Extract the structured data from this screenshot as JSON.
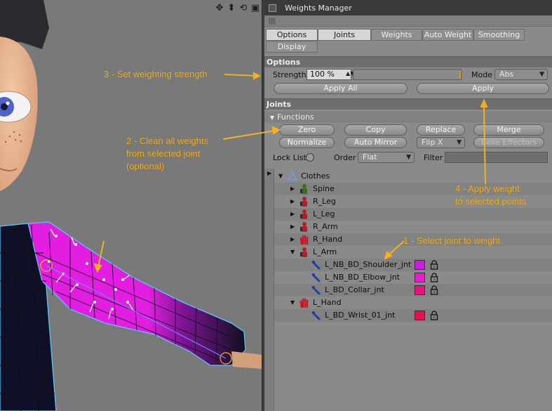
{
  "viewport": {
    "tools": {
      "move": "✥",
      "scale": "⬍",
      "rotate": "⟲",
      "frame": "▣"
    },
    "annotations": {
      "step3": "3 - Set weighting strength",
      "step2_l1": "2 - Clean all weights",
      "step2_l2": "from selected joint",
      "step2_l3": "(optional)",
      "step4_l1": "4 - Apply weight",
      "step4_l2": "to selected points",
      "step1": "1 - Select joint to weight"
    },
    "colors": {
      "annotation": "#f3b11d",
      "weight_paint": "#e61ee6",
      "mesh_wire": "#0f0f2a"
    }
  },
  "panel": {
    "title": "Weights Manager",
    "tabs": [
      "Options",
      "Joints",
      "Weights",
      "Auto Weight",
      "Smoothing",
      "Display"
    ],
    "active_tabs": [
      "Options",
      "Joints"
    ],
    "options": {
      "header": "Options",
      "strength_label": "Strength",
      "strength_value": "100 %",
      "strength_fraction": 1.0,
      "mode_label": "Mode",
      "mode_value": "Abs",
      "apply_all": "Apply All",
      "apply": "Apply"
    },
    "joints": {
      "header": "Joints",
      "functions_label": "Functions",
      "buttons": {
        "zero": "Zero",
        "copy": "Copy",
        "replace": "Replace",
        "merge": "Merge",
        "normalize": "Normalize",
        "auto_mirror": "Auto Mirror",
        "flip": "Flip X",
        "bake": "Bake Effectors"
      },
      "lock_list": "Lock List",
      "order_label": "Order",
      "order_value": "Flat",
      "filter_label": "Filter",
      "filter_value": ""
    },
    "tree": [
      {
        "label": "Clothes",
        "icon": "polygon-object-icon"
      },
      {
        "label": "Spine",
        "icon": "spine-joint-icon"
      },
      {
        "label": "R_Leg",
        "icon": "leg-joint-icon"
      },
      {
        "label": "L_Leg",
        "icon": "leg-joint-icon"
      },
      {
        "label": "R_Arm",
        "icon": "arm-joint-icon"
      },
      {
        "label": "R_Hand",
        "icon": "hand-joint-icon"
      },
      {
        "label": "L_Arm",
        "icon": "arm-joint-icon"
      },
      {
        "label": "L_NB_BD_Shoulder_jnt",
        "icon": "bone-icon",
        "swatch": "#c81ee0"
      },
      {
        "label": "L_NB_BD_Elbow_jnt",
        "icon": "bone-icon",
        "swatch": "#e61ec8"
      },
      {
        "label": "L_BD_Collar_jnt",
        "icon": "bone-icon",
        "swatch": "#e0177f"
      },
      {
        "label": "L_Hand",
        "icon": "hand-joint-icon"
      },
      {
        "label": "L_BD_Wrist_01_jnt",
        "icon": "bone-icon",
        "swatch": "#e0144b"
      }
    ]
  }
}
